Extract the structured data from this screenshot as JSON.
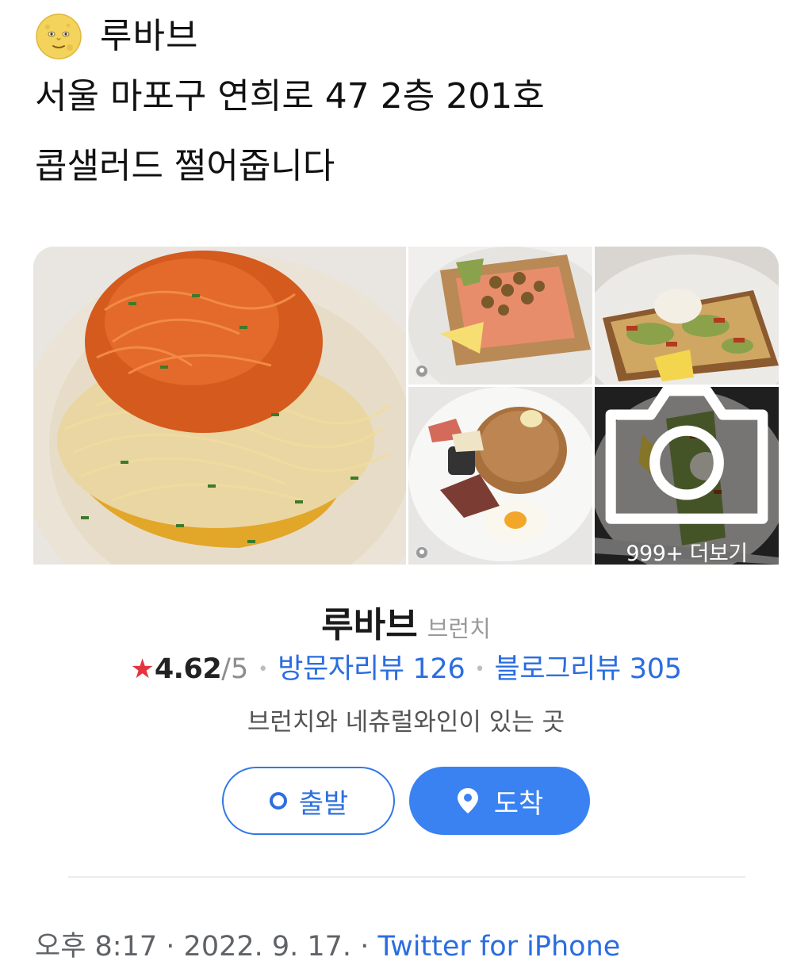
{
  "tweet": {
    "author_name": "루바브",
    "author_emoji": "full-moon-with-face-emoji",
    "text_line1": "서울 마포구 연희로 47 2층 201호",
    "text_line2": "콥샐러드 쩔어줍니다"
  },
  "place_card": {
    "photos": [
      "pasta-with-carrot-photo",
      "salmon-toast-photo",
      "avocado-toast-photo",
      "pancake-brunch-photo",
      "avocado-toast-more-photo"
    ],
    "more_label": "999+ 더보기",
    "name": "루바브",
    "category": "브런치",
    "rating_value": "4.62",
    "rating_max": "/5",
    "visitor_review_label": "방문자리뷰 126",
    "blog_review_label": "블로그리뷰 305",
    "description": "브런치와 네츄럴와인이 있는 곳",
    "depart_label": "출발",
    "arrive_label": "도착"
  },
  "meta": {
    "time": "오후 8:17",
    "separator": "·",
    "date": "2022. 9. 17.",
    "source": "Twitter for iPhone"
  },
  "colors": {
    "accent_blue": "#3a82f2",
    "link_blue": "#2b6de0",
    "star_red": "#e5343f"
  }
}
